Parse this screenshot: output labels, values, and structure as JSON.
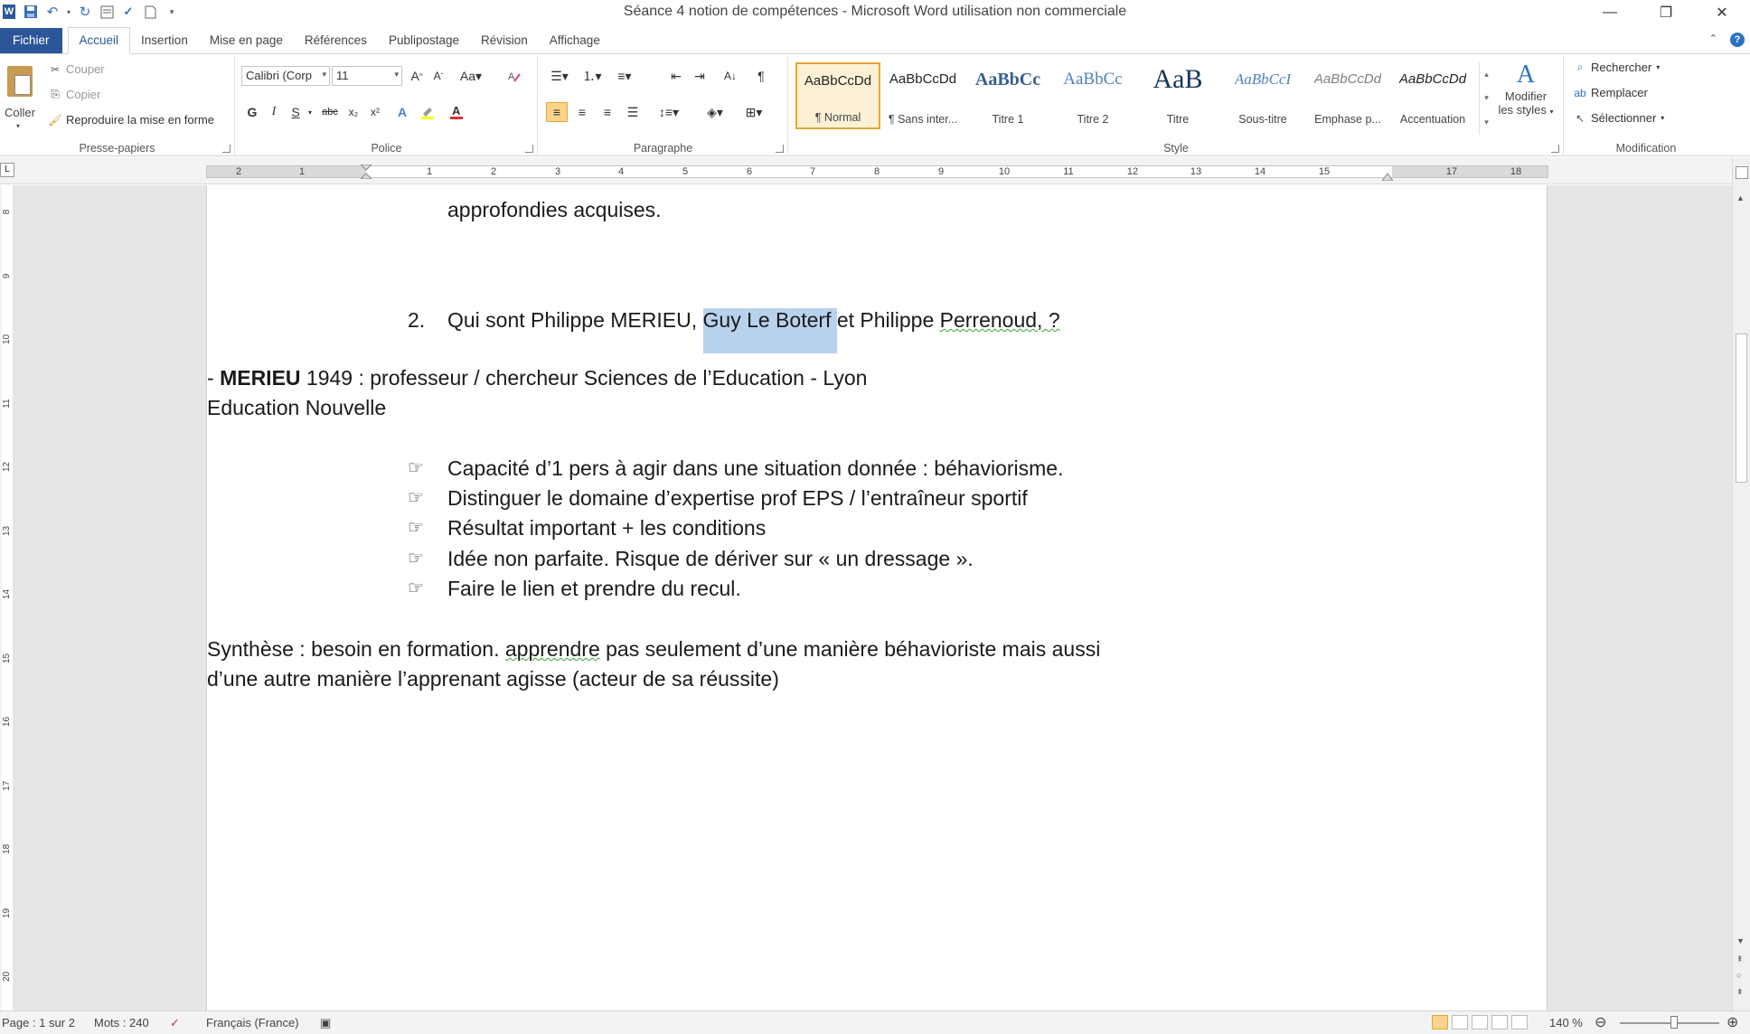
{
  "window": {
    "title": "Séance 4 notion de compétences - Microsoft Word utilisation non commerciale"
  },
  "tabs": {
    "file": "Fichier",
    "items": [
      "Accueil",
      "Insertion",
      "Mise en page",
      "Références",
      "Publipostage",
      "Révision",
      "Affichage"
    ],
    "active": "Accueil"
  },
  "ribbon": {
    "clipboard": {
      "label": "Presse-papiers",
      "paste": "Coller",
      "cut": "Couper",
      "copy": "Copier",
      "format_painter": "Reproduire la mise en forme"
    },
    "font": {
      "label": "Police",
      "font_name": "Calibri (Corp",
      "font_size": "11",
      "bold": "G",
      "italic": "I",
      "underline": "S",
      "strike": "abc",
      "subscript": "x₂",
      "superscript": "x²",
      "font_color": "#e03030",
      "highlight_color": "#ffff00"
    },
    "paragraph": {
      "label": "Paragraphe"
    },
    "styles": {
      "label": "Style",
      "items": [
        {
          "sample": "AaBbCcDd",
          "name": "¶ Normal",
          "selected": true
        },
        {
          "sample": "AaBbCcDd",
          "name": "¶ Sans inter...",
          "selected": false
        },
        {
          "sample": "AaBbCc",
          "name": "Titre 1",
          "selected": false
        },
        {
          "sample": "AaBbCc",
          "name": "Titre 2",
          "selected": false
        },
        {
          "sample": "AaB",
          "name": "Titre",
          "selected": false
        },
        {
          "sample": "AaBbCcI",
          "name": "Sous-titre",
          "selected": false
        },
        {
          "sample": "AaBbCcDd",
          "name": "Emphase p...",
          "selected": false
        },
        {
          "sample": "AaBbCcDd",
          "name": "Accentuation",
          "selected": false
        }
      ],
      "modify_line1": "Modifier",
      "modify_line2": "les styles"
    },
    "editing": {
      "label": "Modification",
      "find": "Rechercher",
      "replace": "Remplacer",
      "select": "Sélectionner"
    }
  },
  "ruler": {
    "ticks": [
      "2",
      "1",
      "1",
      "2",
      "3",
      "4",
      "5",
      "6",
      "7",
      "8",
      "9",
      "10",
      "11",
      "12",
      "13",
      "14",
      "15",
      "17",
      "18"
    ]
  },
  "vruler": {
    "ticks": [
      "8",
      "9",
      "10",
      "11",
      "12",
      "13",
      "14",
      "15",
      "16",
      "17",
      "18",
      "19",
      "20"
    ]
  },
  "document": {
    "line_top": "approfondies acquises.",
    "q2_number": "2.",
    "q2_before": "Qui sont Philippe MERIEU, ",
    "q2_selected": "Guy Le Boterf ",
    "q2_middle": "et Philippe ",
    "q2_squiggle": "Perrenoud, ?",
    "merieu_dash": "- ",
    "merieu_bold": "MERIEU",
    "merieu_rest": " 1949 : professeur / chercheur Sciences de l’Education  -  Lyon",
    "merieu_line2": "Education Nouvelle",
    "bullets": [
      "Capacité d’1 pers à agir dans une situation donnée : béhaviorisme.",
      "Distinguer le domaine d’expertise prof EPS / l’entraîneur sportif",
      "Résultat important + les conditions",
      "Idée non parfaite. Risque de dériver sur « un dressage ».",
      "Faire le lien et prendre du recul."
    ],
    "synth_before": "Synthèse : besoin en formation.  ",
    "synth_squiggle": "apprendre",
    "synth_after": " pas seulement d’une manière béhavioriste mais aussi",
    "synth_line2": "d’une autre manière l’apprenant agisse (acteur de sa réussite)"
  },
  "statusbar": {
    "page": "Page : 1 sur 2",
    "words": "Mots : 240",
    "language": "Français (France)",
    "zoom": "140 %"
  }
}
